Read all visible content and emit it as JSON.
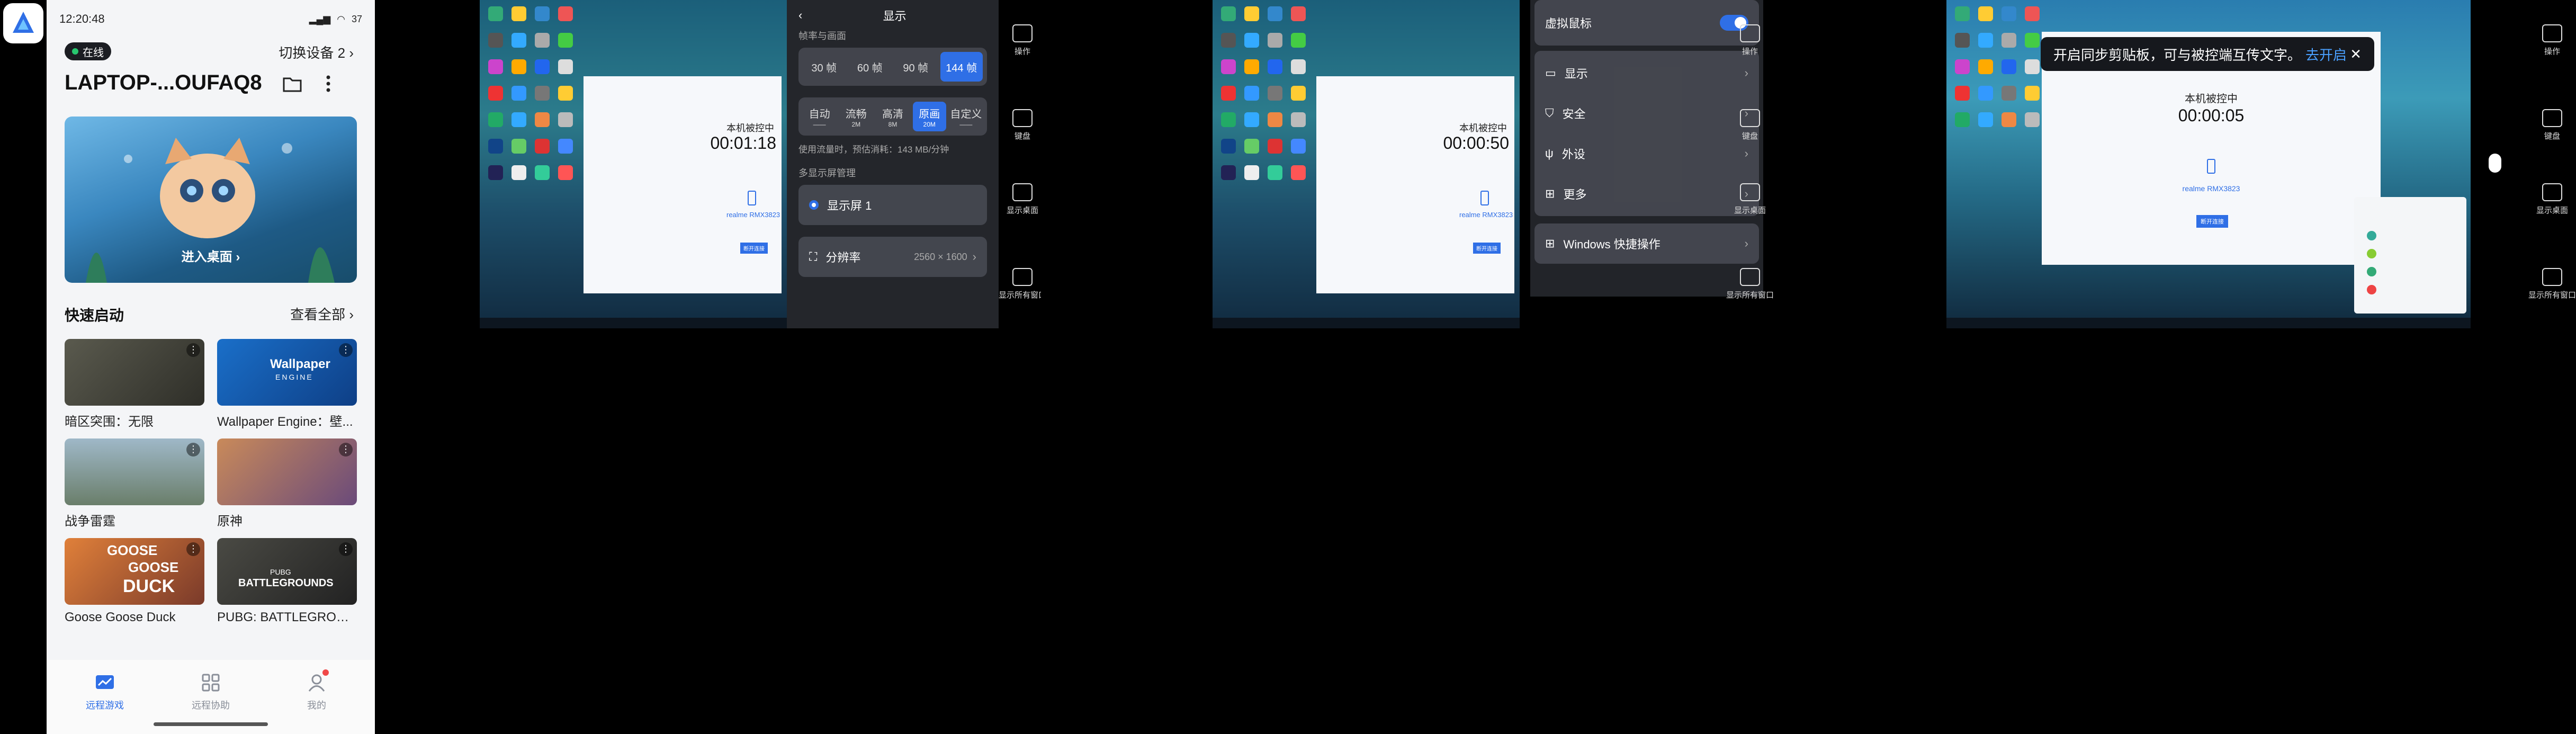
{
  "phone": {
    "time": "12:20:48",
    "battery": "37",
    "status_badge": "在线",
    "switch_label": "切换设备 2",
    "host_name": "LAPTOP-...OUFAQ8",
    "enter_desktop": "进入桌面",
    "quick_start": "快速启动",
    "view_all": "查看全部",
    "games": [
      {
        "name": "暗区突围：无限"
      },
      {
        "name": "Wallpaper Engine：壁..."
      },
      {
        "name": "战争雷霆"
      },
      {
        "name": "原神"
      },
      {
        "name": "Goose Goose Duck"
      },
      {
        "name": "PUBG: BATTLEGROUN..."
      }
    ],
    "thumb_text": {
      "wallpaper": "Wallpaper",
      "engine": "ENGINE",
      "goose": "GOOSE",
      "goose2": "GOOSE",
      "duck": "DUCK",
      "pubg": "PUBG",
      "battlegrounds": "BATTLEGROUNDS"
    },
    "nav": [
      {
        "label": "远程游戏"
      },
      {
        "label": "远程协助"
      },
      {
        "label": "我的"
      }
    ]
  },
  "remote_window": {
    "title": "本机被控中",
    "device": "realme RMX3823",
    "button": "断开连接"
  },
  "shot1": {
    "timer": "00:01:18",
    "panel_title": "显示",
    "fps_label": "帧率与画面",
    "fps": [
      "30 帧",
      "60 帧",
      "90 帧",
      "144 帧"
    ],
    "quality": [
      {
        "name": "自动",
        "sub": "——"
      },
      {
        "name": "流畅",
        "sub": "2M"
      },
      {
        "name": "高清",
        "sub": "8M"
      },
      {
        "name": "原画",
        "sub": "20M"
      },
      {
        "name": "自定义",
        "sub": "——"
      }
    ],
    "usage": "使用流量时，预估消耗：143 MB/分钟",
    "multi_label": "多显示屏管理",
    "display_name": "显示屏 1",
    "resolution_label": "分辨率",
    "resolution_value": "2560 × 1600"
  },
  "shot2": {
    "timer": "00:00:50",
    "virtual_mouse": "虚拟鼠标",
    "menu": [
      "显示",
      "安全",
      "外设",
      "更多"
    ],
    "windows_ops": "Windows 快捷操作"
  },
  "shot3": {
    "timer": "00:00:05",
    "toast": "开启同步剪贴板，可与被控端互传文字。",
    "toast_action": "去开启"
  },
  "side_labels": [
    "操作",
    "键盘",
    "显示桌面",
    "显示所有窗口"
  ],
  "colors": {
    "accent": "#2f6fe6",
    "online": "#28c76f"
  }
}
